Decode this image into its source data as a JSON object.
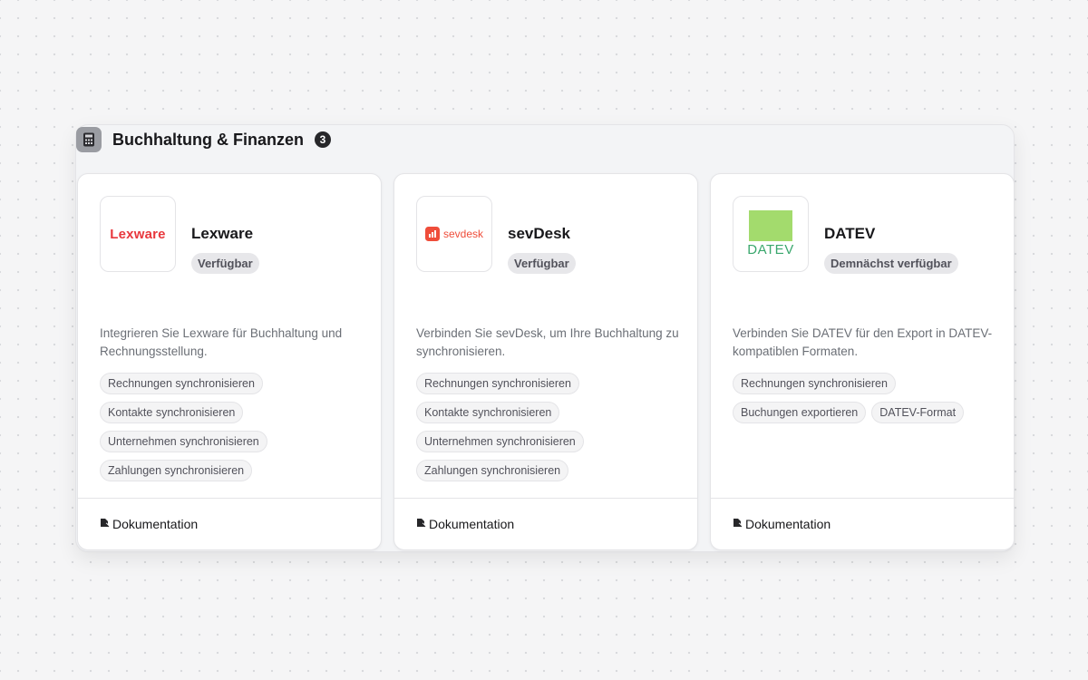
{
  "section": {
    "title": "Buchhaltung & Finanzen",
    "count": "3",
    "icon": "calculator-icon"
  },
  "cards": [
    {
      "name": "Lexware",
      "status": "Verfügbar",
      "logo_text": "Lexware",
      "description": "Integrieren Sie Lexware für Buchhaltung und Rechnungsstellung.",
      "tags": [
        "Rechnungen synchronisieren",
        "Kontakte synchronisieren",
        "Unternehmen synchronisieren",
        "Zahlungen synchronisieren"
      ],
      "doc_label": "Dokumentation"
    },
    {
      "name": "sevDesk",
      "status": "Verfügbar",
      "logo_text": "sevdesk",
      "description": "Verbinden Sie sevDesk, um Ihre Buchhaltung zu synchronisieren.",
      "tags": [
        "Rechnungen synchronisieren",
        "Kontakte synchronisieren",
        "Unternehmen synchronisieren",
        "Zahlungen synchronisieren"
      ],
      "doc_label": "Dokumentation"
    },
    {
      "name": "DATEV",
      "status": "Demnächst verfügbar",
      "logo_text": "DATEV",
      "description": "Verbinden Sie DATEV für den Export in DATEV-kompatiblen Formaten.",
      "tags": [
        "Rechnungen synchronisieren",
        "Buchungen exportieren",
        "DATEV-Format"
      ],
      "doc_label": "Dokumentation"
    }
  ],
  "colors": {
    "lexware": "#e8383d",
    "sevdesk": "#ef4d3a",
    "datev_square": "#a3db6d",
    "datev_text": "#3aa76d"
  }
}
